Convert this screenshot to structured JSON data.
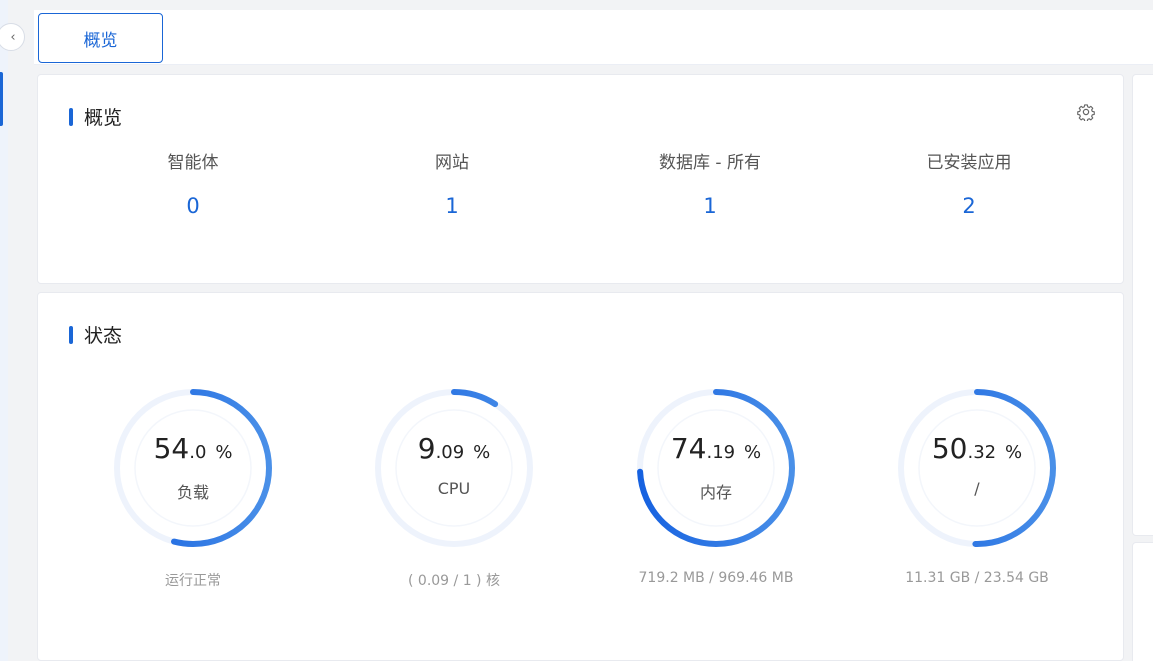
{
  "tabs": [
    {
      "label": "概览"
    }
  ],
  "overview": {
    "title": "概览",
    "stats": [
      {
        "label": "智能体",
        "value": "0"
      },
      {
        "label": "网站",
        "value": "1"
      },
      {
        "label": "数据库 - 所有",
        "value": "1"
      },
      {
        "label": "已安装应用",
        "value": "2"
      }
    ]
  },
  "status": {
    "title": "状态",
    "gauges": [
      {
        "int": "54",
        "dec": ".0",
        "unit": "%",
        "name": "负载",
        "caption": "运行正常",
        "percent": 54.0
      },
      {
        "int": "9",
        "dec": ".09",
        "unit": "%",
        "name": "CPU",
        "caption": "( 0.09 / 1 ) 核",
        "percent": 9.09
      },
      {
        "int": "74",
        "dec": ".19",
        "unit": "%",
        "name": "内存",
        "caption": "719.2 MB / 969.46 MB",
        "percent": 74.19
      },
      {
        "int": "50",
        "dec": ".32",
        "unit": "%",
        "name": "/",
        "caption": "11.31 GB / 23.54 GB",
        "percent": 50.32
      }
    ]
  },
  "colors": {
    "accent": "#1a66d6",
    "gauge_track": "#eef3fc",
    "gauge_start": "#1661e0",
    "gauge_end": "#4a90e8"
  },
  "icons": {
    "collapse": "chevron-left-icon",
    "settings": "gear-icon"
  }
}
